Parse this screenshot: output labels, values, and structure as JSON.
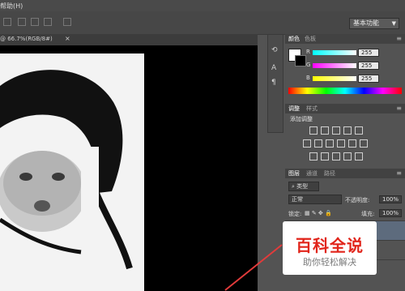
{
  "menubar": {
    "help": "帮助(H)"
  },
  "options_bar": {
    "preset": "基本功能"
  },
  "document": {
    "tab_label": "@ 66.7%(RGB/8#)",
    "close": "×"
  },
  "color_panel": {
    "tabs": [
      "颜色",
      "色板"
    ],
    "channels": [
      {
        "label": "R",
        "value": "255",
        "color": "#ff3a3a"
      },
      {
        "label": "G",
        "value": "255",
        "color": "#3aff3a"
      },
      {
        "label": "B",
        "value": "255",
        "color": "#ffff3a"
      }
    ],
    "foreground": "#ffffff",
    "background": "#000000"
  },
  "adjust_panel": {
    "tabs": [
      "调整",
      "样式"
    ],
    "title": "添加调整"
  },
  "layers_panel": {
    "tabs": [
      "图层",
      "通道",
      "路径"
    ],
    "kind": "类型",
    "blend_mode": "正常",
    "opacity_label": "不透明度:",
    "opacity_value": "100%",
    "lock_label": "锁定:",
    "fill_label": "填充:",
    "fill_value": "100%"
  },
  "watermark": {
    "title": "百科全说",
    "subtitle": "助你轻松解决"
  }
}
